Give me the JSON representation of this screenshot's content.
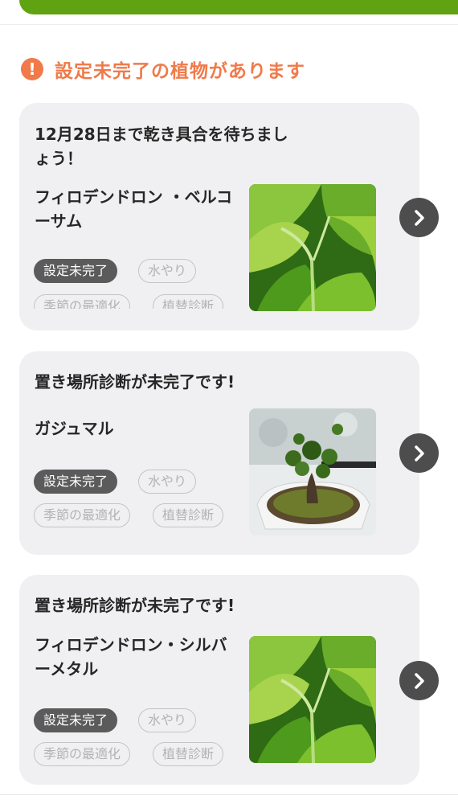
{
  "header": {
    "warning_icon": "exclamation-circle-icon",
    "warning_text": "設定未完了の植物があります",
    "warning_color": "#f07a4a",
    "top_bar_color": "#5fa313"
  },
  "cards": [
    {
      "title": "12月28日まで乾き具合を待ちましょう！",
      "plant_name": "フィロデンドロン ・ベルコーサム",
      "tags": [
        "設定未完了",
        "水やり",
        "季節の最適化",
        "植替診断"
      ]
    },
    {
      "title": "置き場所診断が未完了です!",
      "plant_name": "ガジュマル",
      "tags": [
        "設定未完了",
        "水やり",
        "季節の最適化",
        "植替診断"
      ]
    },
    {
      "title": "置き場所診断が未完了です!",
      "plant_name": "フィロデンドロン・シルバーメタル",
      "tags": [
        "設定未完了",
        "水やり",
        "季節の最適化",
        "植替診断"
      ]
    }
  ]
}
